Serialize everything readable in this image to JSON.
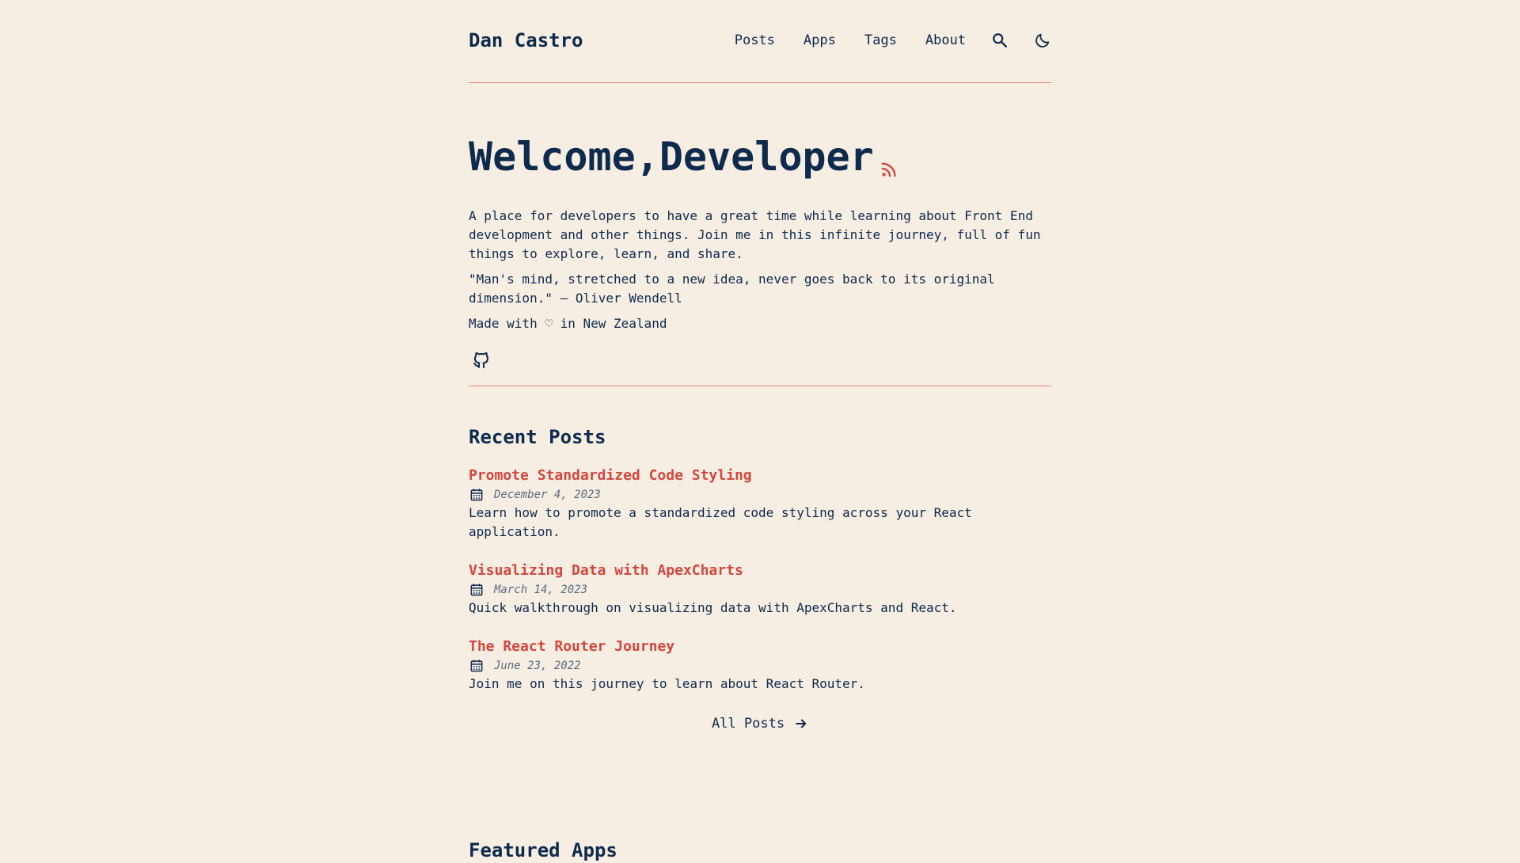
{
  "header": {
    "site_name": "Dan Castro",
    "nav": [
      "Posts",
      "Apps",
      "Tags",
      "About"
    ],
    "search_icon": "search-icon",
    "theme_icon": "moon-icon"
  },
  "hero": {
    "title": "Welcome,Developer",
    "rss_icon": "rss-icon",
    "intro": "A place for developers to have a great time while learning about Front End development and other things. Join me in this infinite journey, full of fun things to explore, learn, and share.",
    "quote": "\"Man's mind, stretched to a new idea, never goes back to its original dimension.\" – Oliver Wendell",
    "made_with": "Made with ♡ in New Zealand",
    "social_icon": "github-icon"
  },
  "recent": {
    "title": "Recent Posts",
    "posts": [
      {
        "title": "Promote Standardized Code Styling",
        "date": "December 4, 2023",
        "description": "Learn how to promote a standardized code styling across your React application."
      },
      {
        "title": "Visualizing Data with ApexCharts",
        "date": "March 14, 2023",
        "description": "Quick walkthrough on visualizing data with ApexCharts and React."
      },
      {
        "title": "The React Router Journey",
        "date": "June 23, 2022",
        "description": "Join me on this journey to learn about React Router."
      }
    ],
    "all_posts_label": "All Posts"
  },
  "featured": {
    "title": "Featured Apps"
  },
  "colors": {
    "background": "#f6eee3",
    "text": "#0e2a4d",
    "accent": "#d4463e",
    "divider": "#e07b7b"
  }
}
